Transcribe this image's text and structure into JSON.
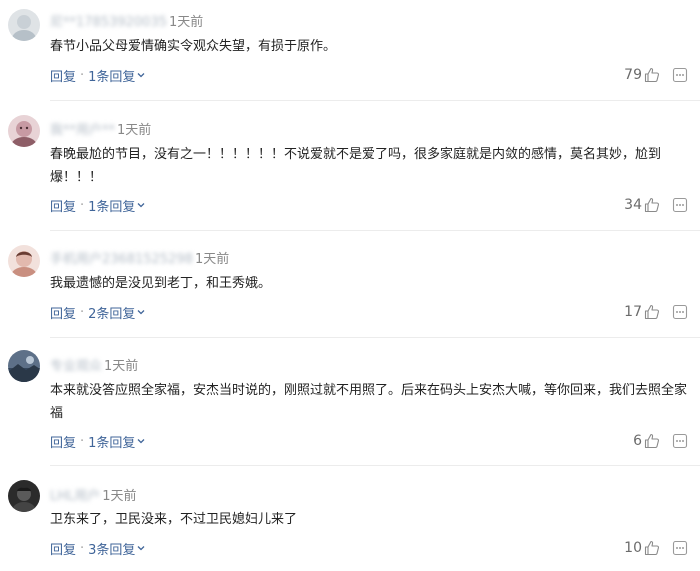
{
  "comments": [
    {
      "username": "尼**17853920035",
      "time": "1天前",
      "text": "春节小品父母爱情确实令观众失望，有损于原作。",
      "reply": "回复",
      "sep": "·",
      "reply_count": "1条回复",
      "likes": "79"
    },
    {
      "username": "我**用户**",
      "time": "1天前",
      "text": "春晚最尬的节目，没有之一！！！！！！不说爱就不是爱了吗，很多家庭就是内敛的感情，莫名其妙，尬到爆！！！",
      "reply": "回复",
      "sep": "·",
      "reply_count": "1条回复",
      "likes": "34"
    },
    {
      "username": "手机用户23681525298",
      "time": "1天前",
      "text": "我最遗憾的是没见到老丁，和王秀娥。",
      "reply": "回复",
      "sep": "·",
      "reply_count": "2条回复",
      "likes": "17"
    },
    {
      "username": "专业观众",
      "time": "1天前",
      "text": "本来就没答应照全家福，安杰当时说的，刚照过就不用照了。后来在码头上安杰大喊，等你回来，我们去照全家福",
      "reply": "回复",
      "sep": "·",
      "reply_count": "1条回复",
      "likes": "6"
    },
    {
      "username": "LHL用户",
      "time": "1天前",
      "text": "卫东来了，卫民没来，不过卫民媳妇儿来了",
      "reply": "回复",
      "sep": "·",
      "reply_count": "3条回复",
      "likes": "10"
    }
  ],
  "colors": {
    "link": "#406599",
    "time": "#888888",
    "text": "#222222",
    "divider": "#ececec"
  }
}
